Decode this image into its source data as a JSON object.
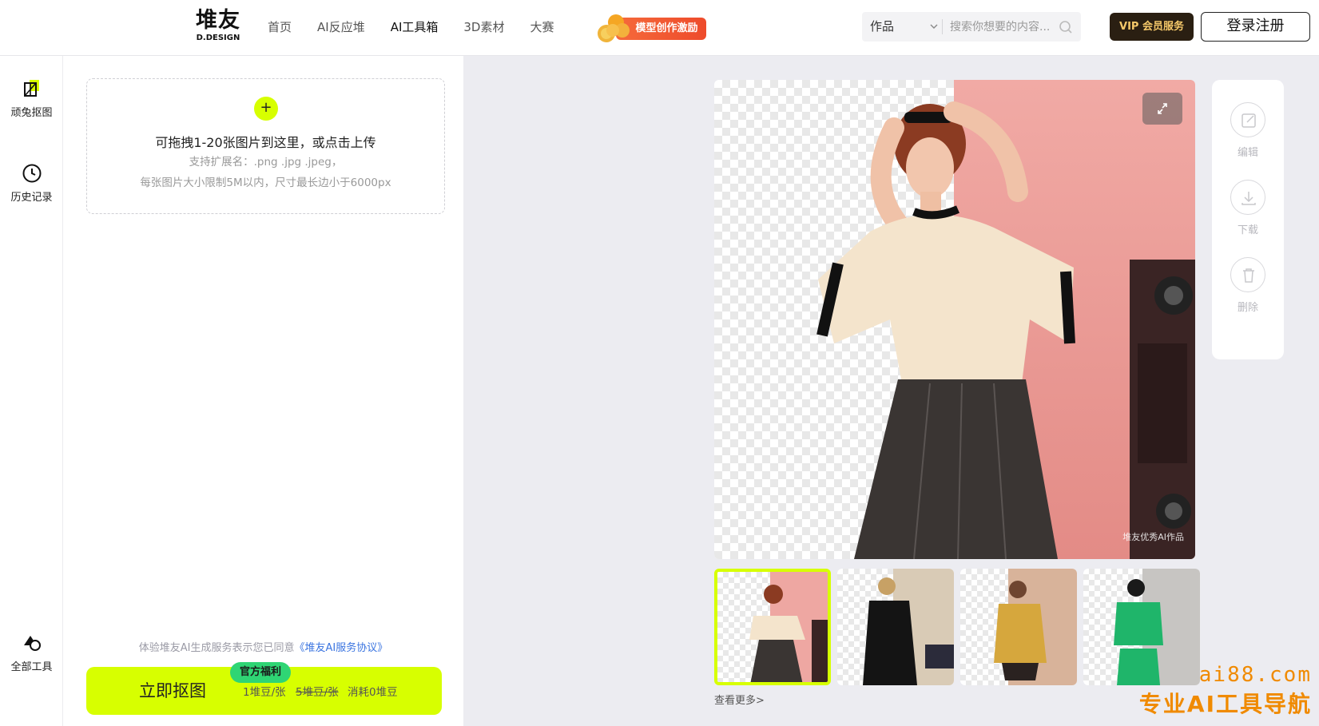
{
  "header": {
    "logo": {
      "main": "堆友",
      "sub": "D.DESIGN"
    },
    "nav": [
      {
        "label": "首页"
      },
      {
        "label": "AI反应堆"
      },
      {
        "label": "AI工具箱",
        "active": true
      },
      {
        "label": "3D素材"
      },
      {
        "label": "大赛"
      }
    ],
    "promo_label": "模型创作激励",
    "search": {
      "category": "作品",
      "placeholder": "搜索你想要的内容..."
    },
    "vip_label": "VIP 会员服务",
    "login_label": "登录注册"
  },
  "rail": {
    "items": [
      {
        "label": "顽兔抠图",
        "icon": "cutout-icon"
      },
      {
        "label": "历史记录",
        "icon": "clock-icon"
      }
    ],
    "bottom": {
      "label": "全部工具",
      "icon": "shapes-icon"
    }
  },
  "upload": {
    "plus": "+",
    "title": "可拖拽1-20张图片到这里，或点击上传",
    "hint_ext": "支持扩展名：.png .jpg .jpeg，",
    "hint_size": "每张图片大小限制5M以内，尺寸最长边小于6000px"
  },
  "agreement": {
    "text": "体验堆友AI生成服务表示您已同意",
    "link": "《堆友AI服务协议》"
  },
  "cta": {
    "label": "立即抠图",
    "badge": "官方福利",
    "price": "1堆豆/张",
    "old_price": "5堆豆/张",
    "consume": "消耗0堆豆"
  },
  "preview": {
    "watermark": "堆友优秀AI作品"
  },
  "tools": [
    {
      "label": "编辑",
      "icon": "edit-icon"
    },
    {
      "label": "下载",
      "icon": "download-icon"
    },
    {
      "label": "删除",
      "icon": "trash-icon"
    }
  ],
  "more_label": "查看更多>",
  "brand": {
    "top": "ai88.com",
    "bottom": "专业AI工具导航"
  },
  "colors": {
    "accent": "#d7ff00",
    "badge": "#2fd574",
    "link": "#3a74e0",
    "brand": "#f08a00"
  }
}
